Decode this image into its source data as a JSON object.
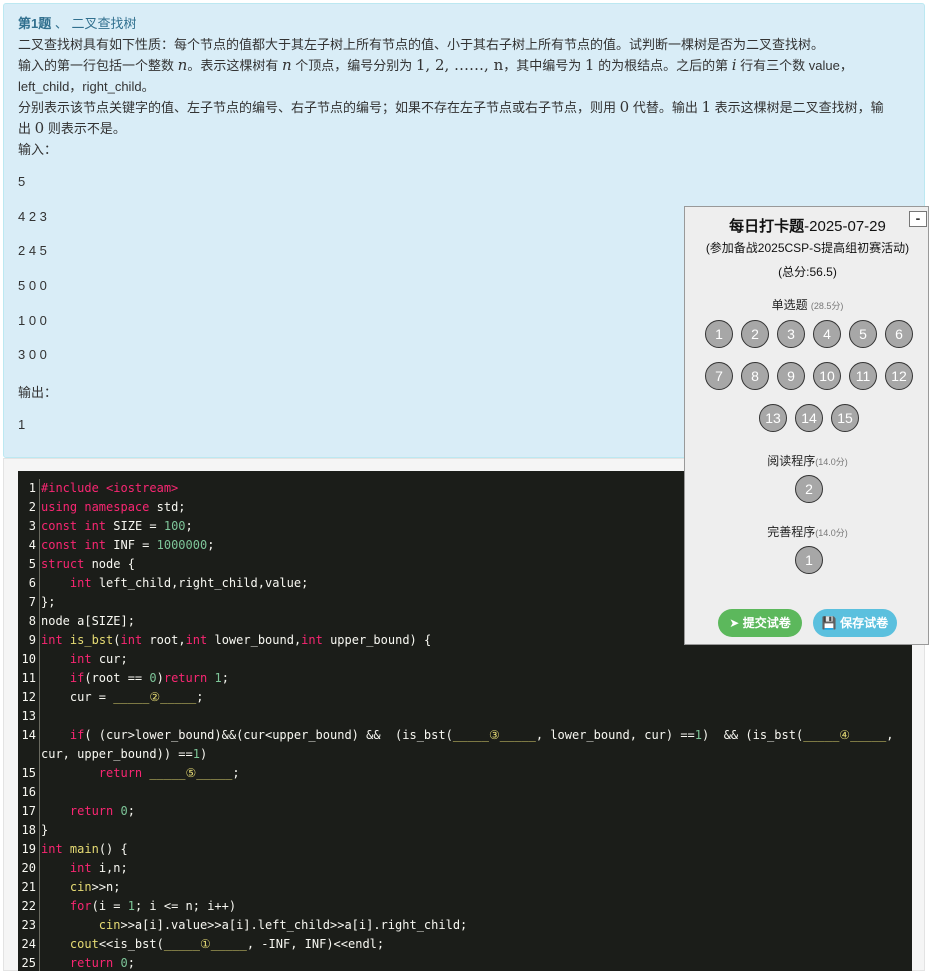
{
  "problem": {
    "number": "第1题",
    "sep": "、",
    "title": "二叉查找树",
    "desc": "二叉查找树具有如下性质：每个节点的值都大于其左子树上所有节点的值、小于其右子树上所有节点的值。试判断一棵树是否为二叉查找树。",
    "line2_a": "输入的第一行包括一个整数",
    "var_n": "n",
    "line2_b": "。表示这棵树有",
    "line2_c": "个顶点，编号分别为",
    "line2_math": "1, 2, ……, n",
    "line2_d": "，其中编号为",
    "one": "1",
    "line2_e": "的为根结点。之后的第",
    "var_i": "i",
    "line2_f": "行有三个数 value，",
    "line3": "left_child，right_child。",
    "line4_a": "分别表示该节点关键字的值、左子节点的编号、右子节点的编号；如果不存在左子节点或右子节点，则用",
    "zero": "0",
    "line4_b": "代替。输出",
    "line4_c": "表示这棵树是二叉查找树，输",
    "line5_a": "出",
    "line5_b": "则表示不是。",
    "input_label": "输入：",
    "input_lines": [
      "5",
      "4 2 3",
      "2 4 5",
      "5 0 0",
      "1 0 0",
      "3 0 0"
    ],
    "output_label": "输出：",
    "output_value": "1"
  },
  "code_lines": [
    "#include <iostream>",
    "using namespace std;",
    "const int SIZE = 100;",
    "const int INF = 1000000;",
    "struct node {",
    "    int left_child,right_child,value;",
    "};",
    "node a[SIZE];",
    "int is_bst(int root,int lower_bound,int upper_bound) {",
    "    int cur;",
    "    if(root == 0)return 1;",
    "    cur = _____②_____;",
    "",
    "    if( (cur>lower_bound)&&(cur<upper_bound) &&  (is_bst(_____③_____, lower_bound, cur) ==1)  && (is_bst(_____④_____,",
    "        return _____⑤_____;",
    "",
    "    return 0;",
    "}",
    "int main() {",
    "    int i,n;",
    "    cin>>n;",
    "    for(i = 1; i <= n; i++)",
    "        cin>>a[i].value>>a[i].left_child>>a[i].right_child;",
    "    cout<<is_bst(_____①_____, -INF, INF)<<endl;",
    "    return 0;"
  ],
  "code_wrap_14": "cur, upper_bound)) ==1)",
  "panel": {
    "title": "每日打卡题",
    "date": "-2025-07-29",
    "subtitle": "(参加备战2025CSP-S提高组初赛活动)",
    "total": "(总分:56.5)",
    "minimize": "-",
    "sections": [
      {
        "label": "单选题",
        "score": "(28.5分)"
      },
      {
        "label": "阅读程序",
        "score": "(14.0分)"
      },
      {
        "label": "完善程序",
        "score": "(14.0分)"
      }
    ],
    "single_choice": [
      "1",
      "2",
      "3",
      "4",
      "5",
      "6",
      "7",
      "8",
      "9",
      "10",
      "11",
      "12",
      "13",
      "14",
      "15"
    ],
    "reading": [
      "2"
    ],
    "completion": [
      "1"
    ],
    "submit": "提交试卷",
    "save": "保存试卷"
  },
  "colors": {
    "accent": "#31708f",
    "problem_bg": "#d9edf7",
    "submit": "#5cb85c",
    "save": "#5bc0de",
    "code_bg": "#1b1d19"
  }
}
